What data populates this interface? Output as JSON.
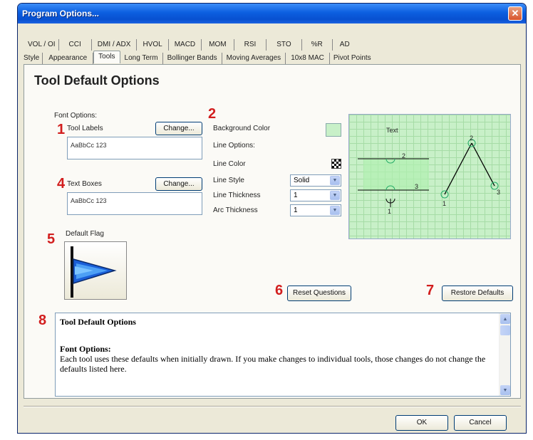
{
  "window": {
    "title": "Program Options..."
  },
  "tabs_row1": [
    "VOL / OI",
    "CCI",
    "DMI / ADX",
    "HVOL",
    "MACD",
    "MOM",
    "RSI",
    "STO",
    "%R",
    "AD"
  ],
  "tabs_row2": [
    "Style",
    "Appearance",
    "Tools",
    "Long Term",
    "Bollinger Bands",
    "Moving Averages",
    "10x8 MAC",
    "Pivot Points"
  ],
  "panel": {
    "title": "Tool Default Options"
  },
  "font_options": {
    "heading": "Font Options:",
    "tool_labels_label": "Tool Labels",
    "tool_labels_change": "Change...",
    "tool_labels_sample": "AaBbCc 123",
    "text_boxes_label": "Text Boxes",
    "text_boxes_change": "Change...",
    "text_boxes_sample": "AaBbCc 123"
  },
  "line_options": {
    "background_color_label": "Background Color",
    "background_color": "#c8f0c8",
    "line_options_label": "Line Options:",
    "line_color_label": "Line Color",
    "line_style_label": "Line Style",
    "line_style_value": "Solid",
    "line_thickness_label": "Line Thickness",
    "line_thickness_value": "1",
    "arc_thickness_label": "Arc Thickness",
    "arc_thickness_value": "1"
  },
  "preview": {
    "text": "Text",
    "labels": [
      "2",
      "3",
      "1",
      "2",
      "1",
      "3"
    ]
  },
  "default_flag": {
    "label": "Default Flag",
    "flag_color": "#1a5fd8"
  },
  "buttons": {
    "reset_questions": "Reset Questions",
    "restore_defaults": "Restore Defaults",
    "ok": "OK",
    "cancel": "Cancel"
  },
  "help": {
    "heading": "Tool Default Options",
    "subheading": "Font Options:",
    "body": "Each tool uses these defaults when initially drawn.  If you make changes to individual tools, those changes do not change the defaults listed here."
  },
  "callouts": [
    "1",
    "2",
    "3",
    "4",
    "5",
    "6",
    "7",
    "8"
  ],
  "colors": {
    "callout": "#d21e1e",
    "titlebar": "#0c5fe0"
  }
}
